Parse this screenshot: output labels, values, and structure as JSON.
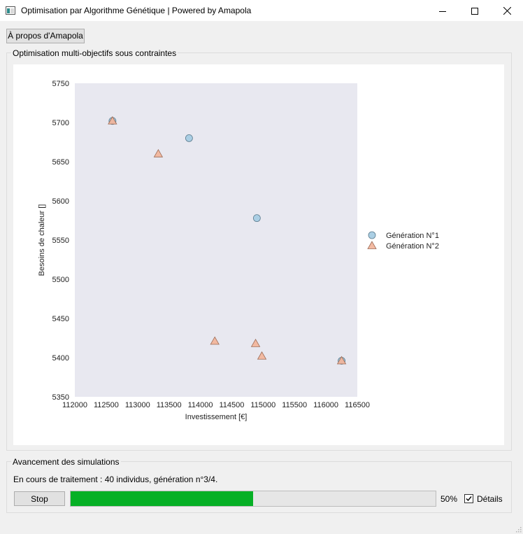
{
  "window": {
    "title": "Optimisation par Algorithme Génétique | Powered by Amapola"
  },
  "toolbar": {
    "about_label": "À propos d'Amapola"
  },
  "chart_group": {
    "title": "Optimisation multi-objectifs sous contraintes"
  },
  "chart_data": {
    "type": "scatter",
    "title": "",
    "xlabel": "Investissement [€]",
    "ylabel": "Besoins de chaleur []",
    "xlim": [
      112000,
      116500
    ],
    "ylim": [
      5350,
      5750
    ],
    "xticks": [
      112000,
      112500,
      113000,
      113500,
      114000,
      114500,
      115000,
      115500,
      116000,
      116500
    ],
    "yticks": [
      5350,
      5400,
      5450,
      5500,
      5550,
      5600,
      5650,
      5700,
      5750
    ],
    "grid": false,
    "legend": "right",
    "background": "#e8e8f0",
    "series": [
      {
        "name": "Génération N°1",
        "marker": "circle",
        "color": "#a6cce3",
        "points": [
          {
            "x": 112600,
            "y": 5702
          },
          {
            "x": 113820,
            "y": 5680
          },
          {
            "x": 114900,
            "y": 5578
          },
          {
            "x": 116250,
            "y": 5396
          }
        ]
      },
      {
        "name": "Génération N°2",
        "marker": "triangle",
        "color": "#f2b49a",
        "points": [
          {
            "x": 112600,
            "y": 5702
          },
          {
            "x": 113330,
            "y": 5660
          },
          {
            "x": 114230,
            "y": 5421
          },
          {
            "x": 114880,
            "y": 5418
          },
          {
            "x": 114980,
            "y": 5402
          },
          {
            "x": 116250,
            "y": 5396
          }
        ]
      }
    ]
  },
  "progress_group": {
    "title": "Avancement des simulations",
    "status": "En cours de traitement : 40 individus, génération n°3/4.",
    "stop_label": "Stop",
    "progress": 0.5,
    "progress_text": "50%",
    "details_label": "Détails",
    "details_checked": true
  }
}
